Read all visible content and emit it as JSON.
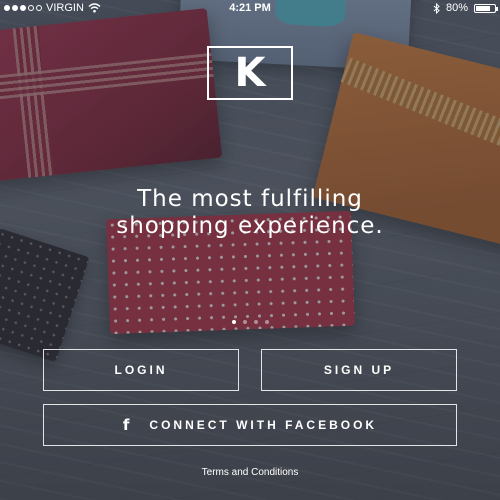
{
  "status_bar": {
    "carrier": "VIRGIN",
    "time": "4:21 PM",
    "battery": "80%",
    "battery_level": 0.8,
    "signal_strength": 3,
    "signal_max": 5,
    "icons": [
      "wifi-icon",
      "bluetooth-icon",
      "battery-icon"
    ]
  },
  "brand": {
    "logo_letter": "K"
  },
  "hero": {
    "tagline_line1": "The most fulfilling",
    "tagline_line2": "shopping experience."
  },
  "pager": {
    "count": 4,
    "active_index": 0
  },
  "actions": {
    "login_label": "LOGIN",
    "signup_label": "SIGN UP",
    "facebook_label": "CONNECT WITH FACEBOOK",
    "facebook_icon": "f"
  },
  "footer": {
    "terms_label": "Terms and Conditions"
  },
  "colors": {
    "text": "#ffffff",
    "overlay": "#282c36"
  }
}
